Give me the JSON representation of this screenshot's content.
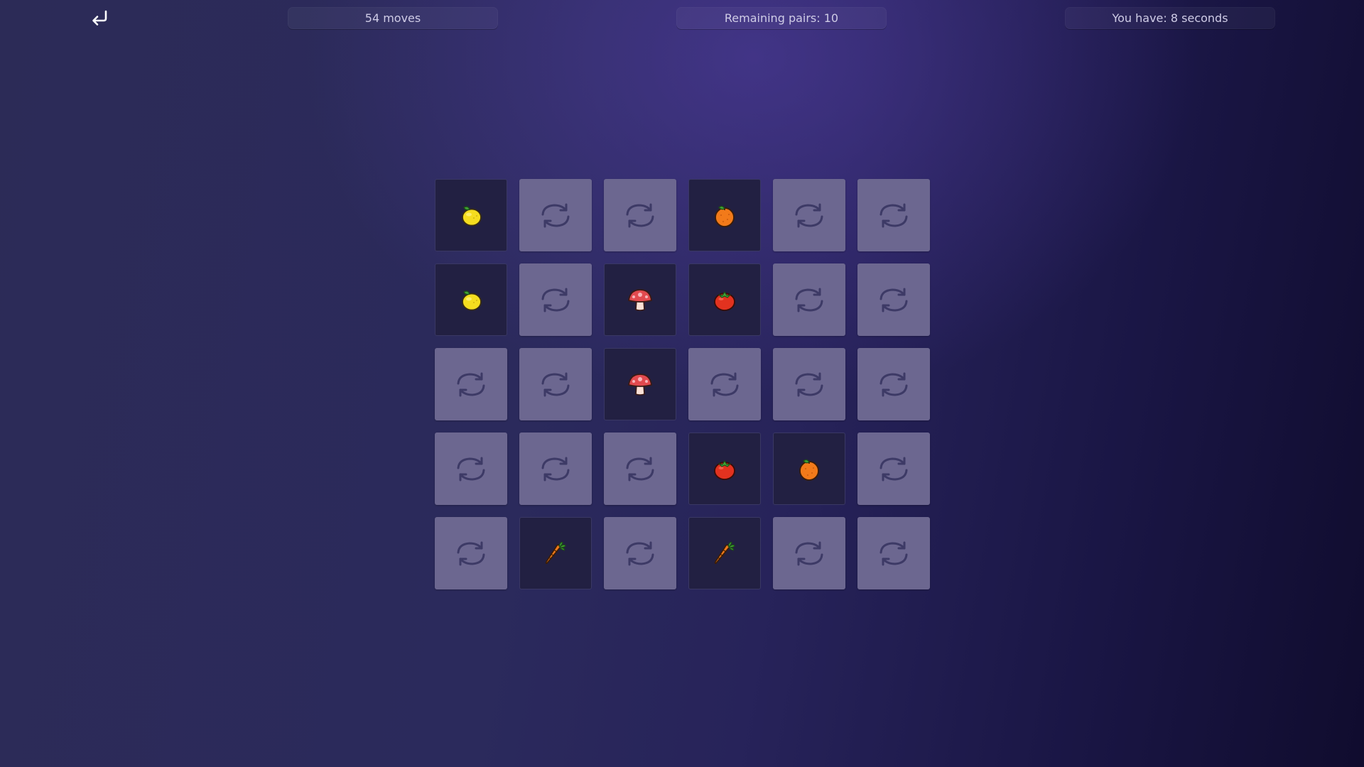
{
  "header": {
    "back_icon": "return-arrow-icon",
    "moves_text": "54 moves",
    "remaining_pairs_text": "Remaining pairs: 10",
    "timer_text": "You have: 8 seconds"
  },
  "board": {
    "rows": 5,
    "columns": 6,
    "hidden_card_icon": "flip-arrows-icon",
    "cards": [
      "lemon",
      "hidden",
      "hidden",
      "orange",
      "hidden",
      "hidden",
      "lemon",
      "hidden",
      "mushroom",
      "tomato",
      "hidden",
      "hidden",
      "hidden",
      "hidden",
      "mushroom",
      "hidden",
      "hidden",
      "hidden",
      "hidden",
      "hidden",
      "hidden",
      "tomato",
      "orange",
      "hidden",
      "hidden",
      "carrot",
      "hidden",
      "carrot",
      "hidden",
      "hidden"
    ]
  },
  "colors": {
    "hidden_card": "#6c6790",
    "revealed_card": "#222042",
    "flip_icon": "#3d3a66"
  }
}
